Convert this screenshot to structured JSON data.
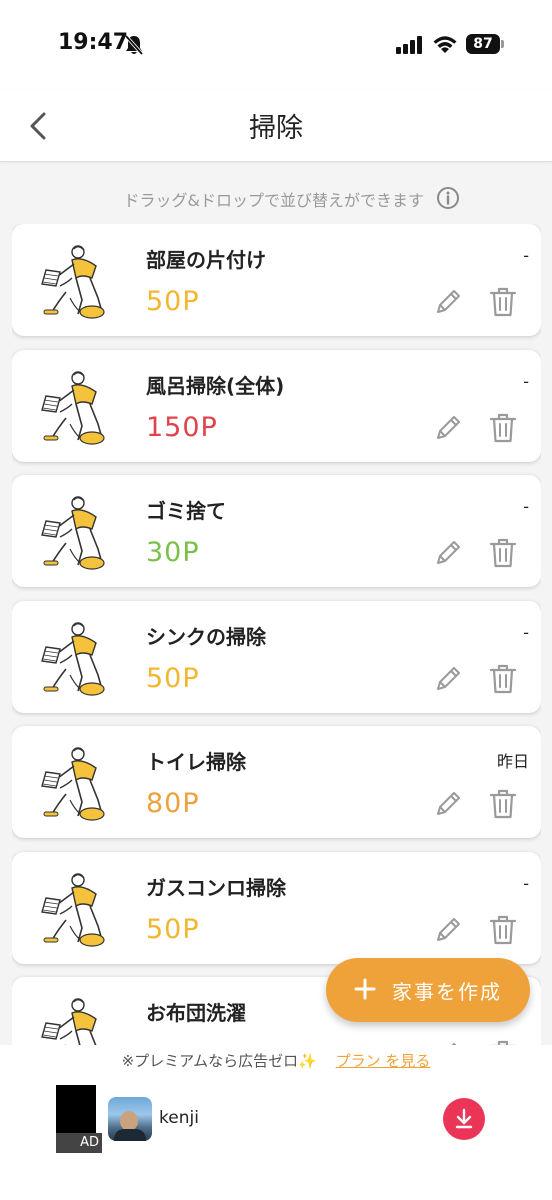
{
  "status_bar": {
    "time": "19:47",
    "battery": "87"
  },
  "nav": {
    "title": "掃除"
  },
  "hint": {
    "text": "ドラッグ&ドロップで並び替えができます"
  },
  "chores": [
    {
      "name": "部屋の片付け",
      "points": "50P",
      "points_color": "#f3b72f",
      "date": "-"
    },
    {
      "name": "風呂掃除(全体)",
      "points": "150P",
      "points_color": "#e1434b",
      "date": "-"
    },
    {
      "name": "ゴミ捨て",
      "points": "30P",
      "points_color": "#7cc04a",
      "date": "-"
    },
    {
      "name": "シンクの掃除",
      "points": "50P",
      "points_color": "#f3b72f",
      "date": "-"
    },
    {
      "name": "トイレ掃除",
      "points": "80P",
      "points_color": "#eda13b",
      "date": "昨日"
    },
    {
      "name": "ガスコンロ掃除",
      "points": "50P",
      "points_color": "#f3b72f",
      "date": "-"
    },
    {
      "name": "お布団洗濯",
      "points": "",
      "points_color": "#f3b72f",
      "date": ""
    }
  ],
  "fab": {
    "label": "家事を作成"
  },
  "premium": {
    "text": "※プレミアムなら広告ゼロ",
    "link": "プラン を見る"
  },
  "ad": {
    "badge": "AD",
    "name": "kenji"
  },
  "colors": {
    "accent": "#f0a23a",
    "download": "#ea3557"
  }
}
